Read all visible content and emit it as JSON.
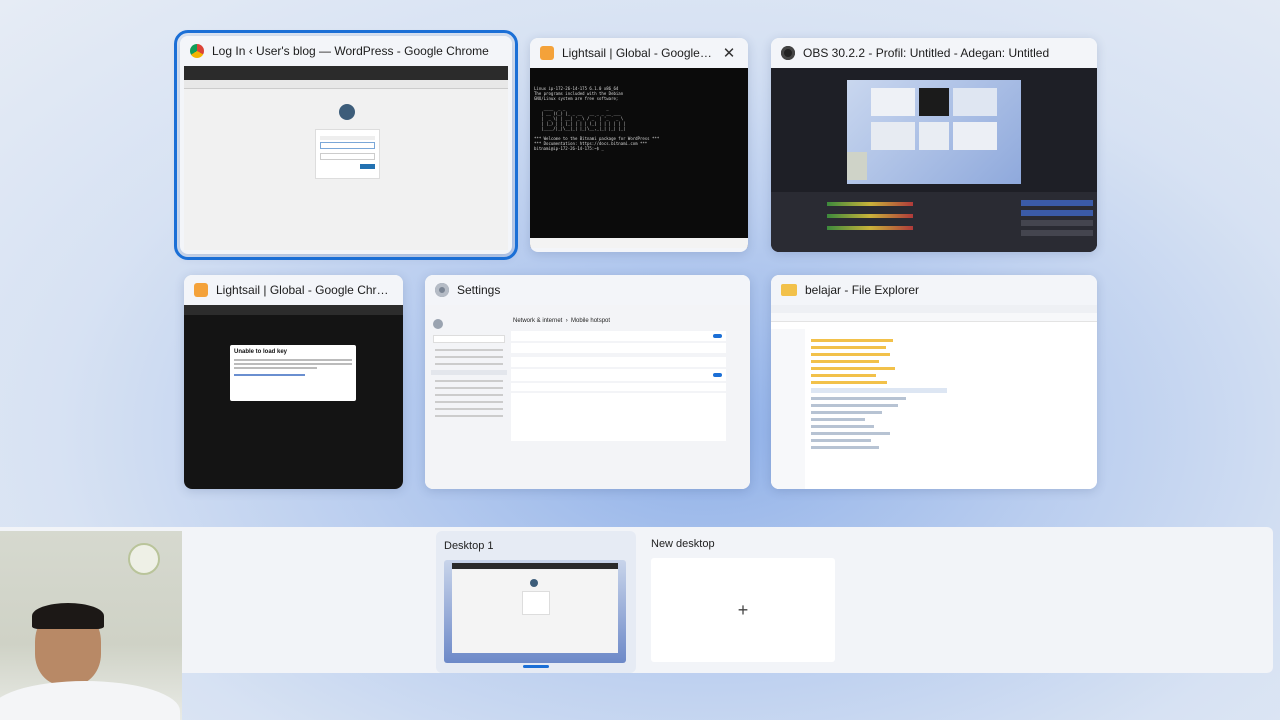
{
  "windows": {
    "w1": {
      "title": "Log In ‹ User's blog — WordPress - Google Chrome",
      "icon": "chrome-icon"
    },
    "w2": {
      "title": "Lightsail | Global - Google Chr...",
      "close": "✕",
      "icon": "lightsail-icon"
    },
    "w3": {
      "title": "OBS 30.2.2 - Profil: Untitled - Adegan: Untitled",
      "icon": "obs-icon"
    },
    "w4": {
      "title": "Lightsail | Global - Google Chrome",
      "icon": "lightsail-icon",
      "dialog_title": "Unable to load key"
    },
    "w5": {
      "title": "Settings",
      "icon": "gear-icon",
      "breadcrumb": "Network & internet  ›  Mobile hotspot"
    },
    "w6": {
      "title": "belajar - File Explorer",
      "icon": "folder-icon"
    }
  },
  "desktops": {
    "d1": {
      "label": "Desktop 1"
    },
    "new": {
      "label": "New desktop",
      "plus": "+"
    }
  },
  "colors": {
    "accent": "#1b6fd6",
    "lightsail": "#f4a23a"
  }
}
